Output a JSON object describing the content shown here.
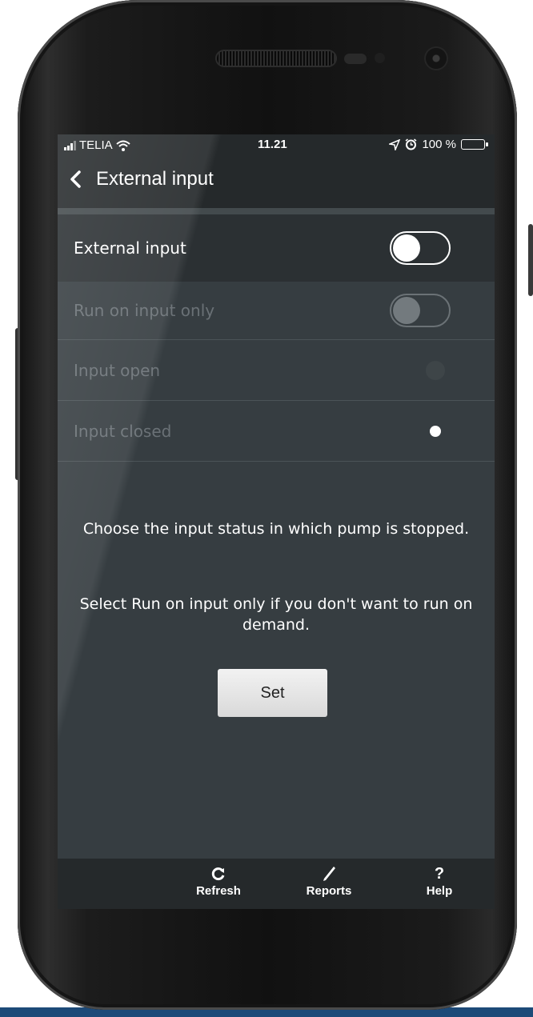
{
  "status_bar": {
    "carrier": "TELIA",
    "time": "11.21",
    "battery_text": "100 %",
    "icons": [
      "signal-icon",
      "wifi-icon",
      "location-icon",
      "alarm-icon",
      "battery-icon"
    ]
  },
  "nav": {
    "back_icon": "chevron-left-icon",
    "title": "External input"
  },
  "settings": {
    "external_input": {
      "label": "External input",
      "enabled": false
    },
    "run_on_input_only": {
      "label": "Run on input only",
      "enabled": false
    },
    "input_open": {
      "label": "Input open",
      "selected": false
    },
    "input_closed": {
      "label": "Input closed",
      "selected": true
    }
  },
  "info": {
    "line1": "Choose the input status in which pump is stopped.",
    "line2": "Select Run on input only if you don't want to run on demand."
  },
  "set_button": {
    "label": "Set"
  },
  "bottom_tabs": [
    {
      "label": "Refresh",
      "icon": "refresh-icon"
    },
    {
      "label": "Reports",
      "icon": "pencil-icon"
    },
    {
      "label": "Help",
      "icon": "help-icon",
      "glyph": "?"
    }
  ],
  "colors": {
    "screen_bg": "#363d41",
    "bar_bg": "#25292b",
    "active_row_bg": "#2b3033",
    "disabled_text": "#6a7176",
    "accent_blue": "#1d4a78"
  }
}
